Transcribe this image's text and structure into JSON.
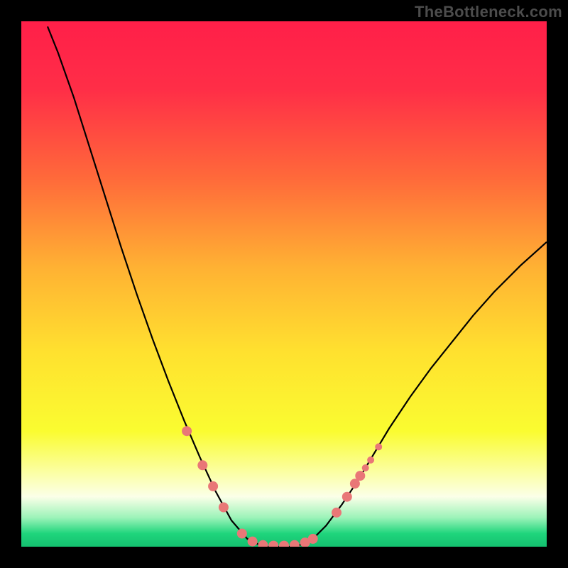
{
  "watermark": "TheBottleneck.com",
  "chart_data": {
    "type": "line",
    "title": "",
    "xlabel": "",
    "ylabel": "",
    "xlim": [
      0,
      100
    ],
    "ylim": [
      0,
      100
    ],
    "gradient_stops": [
      {
        "offset": 0.0,
        "color": "#ff1f49"
      },
      {
        "offset": 0.13,
        "color": "#ff2e47"
      },
      {
        "offset": 0.3,
        "color": "#ff6a3a"
      },
      {
        "offset": 0.47,
        "color": "#ffb233"
      },
      {
        "offset": 0.63,
        "color": "#ffe12f"
      },
      {
        "offset": 0.78,
        "color": "#fafc30"
      },
      {
        "offset": 0.86,
        "color": "#fbffa6"
      },
      {
        "offset": 0.905,
        "color": "#fbffe8"
      },
      {
        "offset": 0.945,
        "color": "#9bf3b8"
      },
      {
        "offset": 0.975,
        "color": "#1fd57c"
      },
      {
        "offset": 1.0,
        "color": "#14c06f"
      }
    ],
    "series": [
      {
        "name": "bottleneck-curve",
        "color": "#000000",
        "points": [
          {
            "x": 5.0,
            "y": 99.0
          },
          {
            "x": 7.0,
            "y": 94.0
          },
          {
            "x": 10.0,
            "y": 85.5
          },
          {
            "x": 13.0,
            "y": 76.0
          },
          {
            "x": 16.0,
            "y": 66.5
          },
          {
            "x": 19.0,
            "y": 57.0
          },
          {
            "x": 22.0,
            "y": 48.0
          },
          {
            "x": 25.0,
            "y": 39.5
          },
          {
            "x": 28.0,
            "y": 31.5
          },
          {
            "x": 31.0,
            "y": 24.0
          },
          {
            "x": 34.0,
            "y": 17.0
          },
          {
            "x": 37.0,
            "y": 10.5
          },
          {
            "x": 40.0,
            "y": 5.0
          },
          {
            "x": 43.0,
            "y": 1.5
          },
          {
            "x": 46.0,
            "y": 0.0
          },
          {
            "x": 49.0,
            "y": 0.0
          },
          {
            "x": 52.0,
            "y": 0.0
          },
          {
            "x": 55.0,
            "y": 1.0
          },
          {
            "x": 58.0,
            "y": 4.0
          },
          {
            "x": 61.0,
            "y": 8.0
          },
          {
            "x": 64.0,
            "y": 12.5
          },
          {
            "x": 67.0,
            "y": 17.5
          },
          {
            "x": 70.0,
            "y": 22.5
          },
          {
            "x": 74.0,
            "y": 28.5
          },
          {
            "x": 78.0,
            "y": 34.0
          },
          {
            "x": 82.0,
            "y": 39.0
          },
          {
            "x": 86.0,
            "y": 44.0
          },
          {
            "x": 90.0,
            "y": 48.5
          },
          {
            "x": 95.0,
            "y": 53.5
          },
          {
            "x": 100.0,
            "y": 58.0
          }
        ]
      }
    ],
    "markers": {
      "color": "#e97777",
      "radius_primary": 7,
      "radius_secondary": 5,
      "points": [
        {
          "x": 31.5,
          "y": 22.0,
          "r": 7
        },
        {
          "x": 34.5,
          "y": 15.5,
          "r": 7
        },
        {
          "x": 36.5,
          "y": 11.5,
          "r": 7
        },
        {
          "x": 38.5,
          "y": 7.5,
          "r": 7
        },
        {
          "x": 42.0,
          "y": 2.5,
          "r": 7
        },
        {
          "x": 44.0,
          "y": 1.0,
          "r": 7
        },
        {
          "x": 46.0,
          "y": 0.3,
          "r": 7
        },
        {
          "x": 48.0,
          "y": 0.2,
          "r": 7
        },
        {
          "x": 50.0,
          "y": 0.2,
          "r": 7
        },
        {
          "x": 52.0,
          "y": 0.3,
          "r": 7
        },
        {
          "x": 54.0,
          "y": 0.8,
          "r": 7
        },
        {
          "x": 55.5,
          "y": 1.5,
          "r": 7
        },
        {
          "x": 60.0,
          "y": 6.5,
          "r": 7
        },
        {
          "x": 62.0,
          "y": 9.5,
          "r": 7
        },
        {
          "x": 63.5,
          "y": 12.0,
          "r": 7
        },
        {
          "x": 64.5,
          "y": 13.5,
          "r": 7
        },
        {
          "x": 65.5,
          "y": 15.0,
          "r": 5
        },
        {
          "x": 66.5,
          "y": 16.5,
          "r": 5
        },
        {
          "x": 68.0,
          "y": 19.0,
          "r": 5
        }
      ]
    }
  }
}
